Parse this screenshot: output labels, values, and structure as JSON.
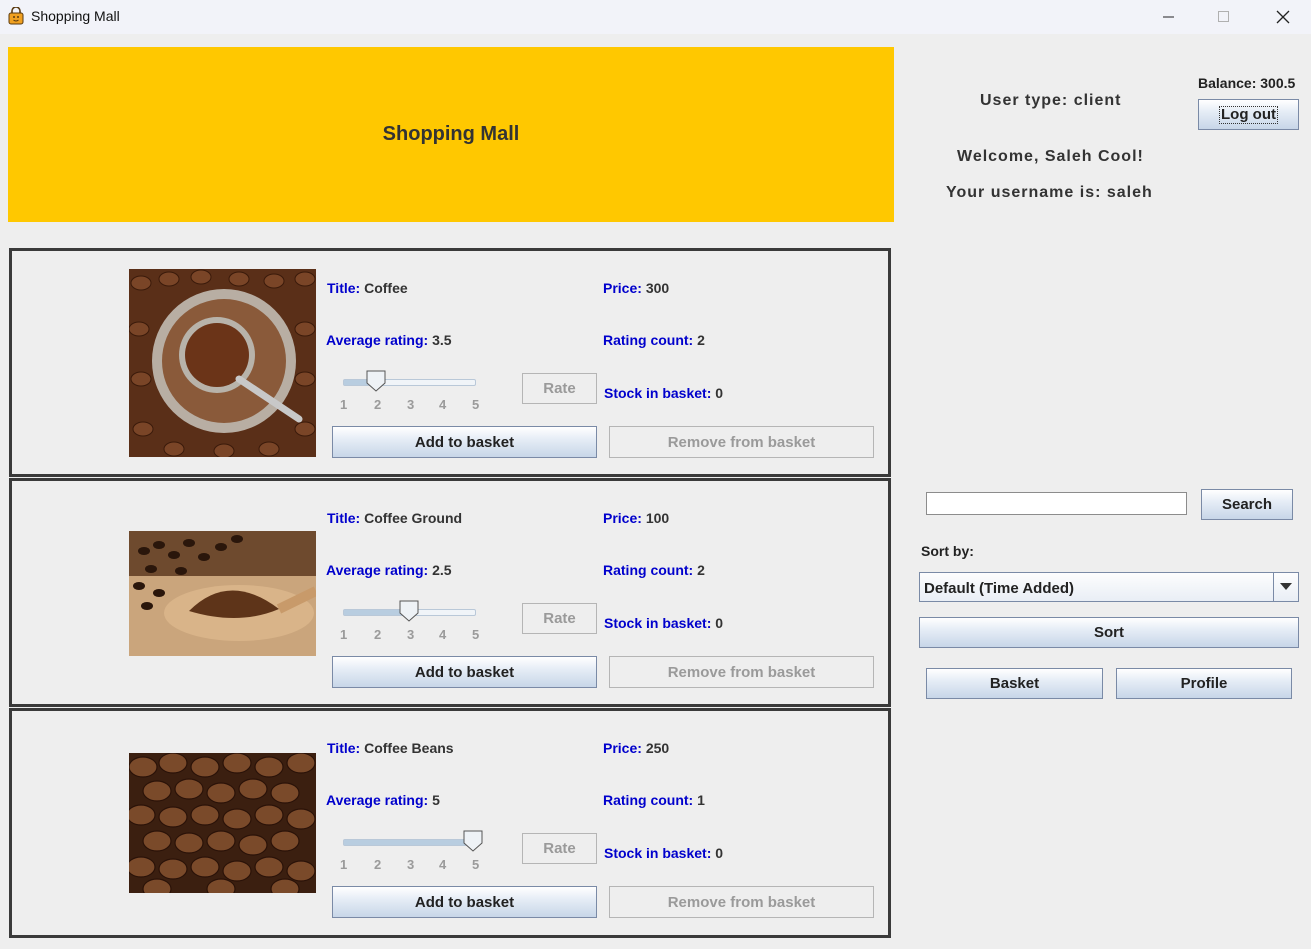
{
  "window": {
    "title": "Shopping Mall",
    "icon": "shopping-bag-icon"
  },
  "banner": {
    "title": "Shopping Mall"
  },
  "user": {
    "user_type": "User type: client",
    "welcome": "Welcome, Saleh Cool!",
    "username": "Your username is: saleh",
    "balance": "Balance: 300.5"
  },
  "buttons": {
    "logout": "Log out",
    "search": "Search",
    "sort": "Sort",
    "basket": "Basket",
    "profile": "Profile"
  },
  "search": {
    "value": "",
    "placeholder": ""
  },
  "sort": {
    "label": "Sort by:",
    "selected": "Default (Time Added)"
  },
  "labels": {
    "title": "Title:",
    "price": "Price:",
    "average_rating": "Average rating:",
    "rating_count": "Rating count:",
    "stock_in_basket": "Stock in basket:",
    "rate": "Rate",
    "add_to_basket": "Add to basket",
    "remove_from_basket": "Remove from basket"
  },
  "slider_ticks": [
    "1",
    "2",
    "3",
    "4",
    "5"
  ],
  "products": [
    {
      "title": "Coffee",
      "price": "300",
      "average_rating": "3.5",
      "rating_count": "2",
      "stock_in_basket": "0",
      "slider_value": 2
    },
    {
      "title": "Coffee Ground",
      "price": "100",
      "average_rating": "2.5",
      "rating_count": "2",
      "stock_in_basket": "0",
      "slider_value": 3
    },
    {
      "title": "Coffee Beans",
      "price": "250",
      "average_rating": "5",
      "rating_count": "1",
      "stock_in_basket": "0",
      "slider_value": 5
    }
  ],
  "colors": {
    "banner": "#ffc800",
    "field_label": "#0000cc",
    "card_border": "#3a3a3a"
  }
}
